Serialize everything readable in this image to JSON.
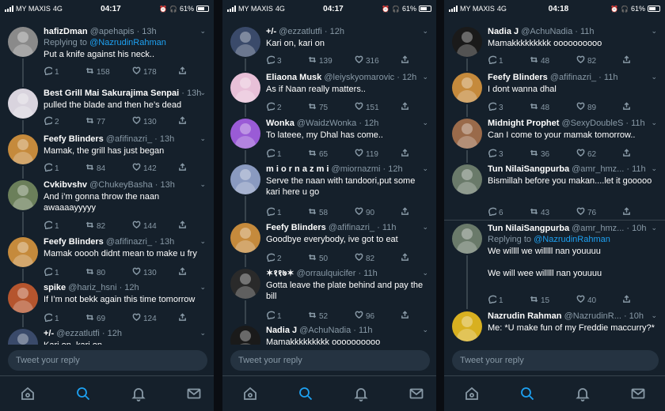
{
  "screens": [
    {
      "status": {
        "carrier": "MY MAXIS",
        "network": "4G",
        "time": "04:17",
        "battery": "61%"
      },
      "tweets": [
        {
          "name": "hafizDman",
          "handle": "@apehapis",
          "time": "13h",
          "reply_to_prefix": "Replying to",
          "reply_to": "@NazrudinRahman",
          "text": "Put a knife against his neck..",
          "replies": "1",
          "retweets": "158",
          "likes": "178",
          "avatar_color": "#8a8a8a"
        },
        {
          "name": "Best Grill Mai Sakurajima Senpai",
          "handle": "",
          "time": "13h",
          "text": "pulled the blade and then he’s dead",
          "replies": "2",
          "retweets": "77",
          "likes": "130",
          "avatar_color": "#d9d4de"
        },
        {
          "name": "Feefy Blinders",
          "handle": "@afifinazri_",
          "time": "13h",
          "text": "Mamak, the grill has just began",
          "replies": "1",
          "retweets": "84",
          "likes": "142",
          "avatar_color": "#c58a3c"
        },
        {
          "name": "Cvkibvshv",
          "handle": "@ChukeyBasha",
          "time": "13h",
          "text": "And i’m gonna throw the naan awaaaayyyyy",
          "replies": "1",
          "retweets": "82",
          "likes": "144",
          "avatar_color": "#6b7f5a"
        },
        {
          "name": "Feefy Blinders",
          "handle": "@afifinazri_",
          "time": "13h",
          "text": "Mamak ooooh didnt mean to make u fry",
          "replies": "1",
          "retweets": "80",
          "likes": "130",
          "avatar_color": "#c58a3c"
        },
        {
          "name": "spike",
          "handle": "@hariz_hsni",
          "time": "12h",
          "text": "If I’m not bekk again this time tomorrow",
          "replies": "1",
          "retweets": "69",
          "likes": "124",
          "avatar_color": "#b5552e"
        },
        {
          "name": "+/-",
          "handle": "@ezzatlutfi",
          "time": "12h",
          "text": "Kari on, kari on",
          "replies": "",
          "retweets": "",
          "likes": "",
          "avatar_color": "#3a4a6a"
        }
      ],
      "composer_placeholder": "Tweet your reply"
    },
    {
      "status": {
        "carrier": "MY MAXIS",
        "network": "4G",
        "time": "04:17",
        "battery": "61%"
      },
      "tweets": [
        {
          "name": "+/-",
          "handle": "@ezzatlutfi",
          "time": "12h",
          "text": "Kari on, kari on",
          "replies": "3",
          "retweets": "139",
          "likes": "316",
          "avatar_color": "#3a4a6a"
        },
        {
          "name": "Eliaona Musk",
          "handle": "@leiyskyomarovic",
          "time": "12h",
          "text": "As if Naan really matters..",
          "replies": "2",
          "retweets": "75",
          "likes": "151",
          "avatar_color": "#e8c0d8"
        },
        {
          "name": "Wonka",
          "handle": "@WaidzWonka",
          "time": "12h",
          "text": "To lateee, my Dhal has come..",
          "replies": "1",
          "retweets": "65",
          "likes": "119",
          "avatar_color": "#9a5bd6"
        },
        {
          "name": "m i o r n a z m i",
          "handle": "@miornazmi",
          "time": "12h",
          "text": "Serve the naan with tandoori,put some kari here u go",
          "replies": "1",
          "retweets": "58",
          "likes": "90",
          "avatar_color": "#8a9ac0"
        },
        {
          "name": "Feefy Blinders",
          "handle": "@afifinazri_",
          "time": "11h",
          "text": "Goodbye everybody, ive got to eat",
          "replies": "2",
          "retweets": "50",
          "likes": "82",
          "avatar_color": "#c58a3c"
        },
        {
          "name": "✶११७✶",
          "handle": "@orraulquicifer",
          "time": "11h",
          "text": "Gotta leave the plate behind and pay the bill",
          "replies": "1",
          "retweets": "52",
          "likes": "96",
          "avatar_color": "#2a2a2a"
        },
        {
          "name": "Nadia J",
          "handle": "@AchuNadia",
          "time": "11h",
          "text": "Mamakkkkkkkkk oooooooooo",
          "replies": "",
          "retweets": "",
          "likes": "",
          "avatar_color": "#1a1a1a"
        }
      ],
      "composer_placeholder": "Tweet your reply"
    },
    {
      "status": {
        "carrier": "MY MAXIS",
        "network": "4G",
        "time": "04:18",
        "battery": "61%"
      },
      "tweets": [
        {
          "name": "Nadia J",
          "handle": "@AchuNadia",
          "time": "11h",
          "text": "Mamakkkkkkkkk oooooooooo",
          "replies": "1",
          "retweets": "48",
          "likes": "82",
          "avatar_color": "#1a1a1a"
        },
        {
          "name": "Feefy Blinders",
          "handle": "@afifinazri_",
          "time": "11h",
          "text": "I dont wanna dhal",
          "replies": "3",
          "retweets": "48",
          "likes": "89",
          "avatar_color": "#c58a3c"
        },
        {
          "name": "Midnight Prophet",
          "handle": "@SexyDoubleS",
          "time": "11h",
          "text": "Can I come to your mamak tomorrow..",
          "replies": "3",
          "retweets": "36",
          "likes": "62",
          "avatar_color": "#9a6a4a"
        },
        {
          "name": "Tun NilaiSangpurba",
          "handle": "@amr_hmz...",
          "time": "11h",
          "text": "Bismillah before you makan....let it gooooo",
          "replies": "6",
          "retweets": "43",
          "likes": "76",
          "avatar_color": "#6a7a6a"
        },
        {
          "name": "Tun NilaiSangpurba",
          "handle": "@amr_hmz...",
          "time": "10h",
          "reply_to_prefix": "Replying to",
          "reply_to": "@NazrudinRahman",
          "text": "We willll we willlll nan youuuu\n\nWe will wee willlll nan youuuu",
          "replies": "1",
          "retweets": "15",
          "likes": "40",
          "avatar_color": "#6a7a6a"
        },
        {
          "name": "Nazrudin Rahman",
          "handle": "@NazrudinR...",
          "time": "10h",
          "text": "Me: *U make fun of my Freddie maccurry?*",
          "replies": "",
          "retweets": "",
          "likes": "",
          "avatar_color": "#d8b020"
        }
      ],
      "composer_placeholder": "Tweet your reply"
    }
  ]
}
